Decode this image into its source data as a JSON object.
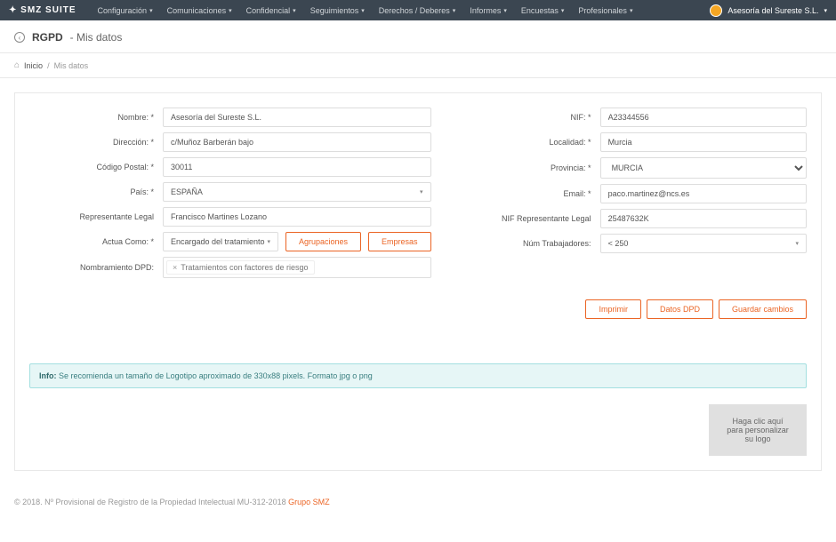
{
  "brand": "SMZ SUITE",
  "nav": [
    "Configuración",
    "Comunicaciones",
    "Confidencial",
    "Seguimientos",
    "Derechos / Deberes",
    "Informes",
    "Encuestas",
    "Profesionales"
  ],
  "user_name": "Asesoría del Sureste S.L.",
  "page": {
    "title_main": "RGPD",
    "title_sub": "- Mis datos"
  },
  "breadcrumb": {
    "home": "Inicio",
    "sep": "/",
    "current": "Mis datos"
  },
  "labels": {
    "nombre": "Nombre: *",
    "nif": "NIF: *",
    "direccion": "Dirección: *",
    "localidad": "Localidad: *",
    "cpostal": "Código Postal: *",
    "provincia": "Provincia: *",
    "pais": "País: *",
    "email": "Email: *",
    "replegal": "Representante Legal",
    "nifrep": "NIF Representante Legal",
    "actua": "Actua Como: *",
    "ntrab": "Núm Trabajadores:",
    "dpd": "Nombramiento DPD:"
  },
  "values": {
    "nombre": "Asesoría del Sureste S.L.",
    "nif": "A23344556",
    "direccion": "c/Muñoz Barberán bajo",
    "localidad": "Murcia",
    "cpostal": "30011",
    "provincia": "MURCIA",
    "pais": "ESPAÑA",
    "email": "paco.martinez@ncs.es",
    "replegal": "Francisco Martines Lozano",
    "nifrep": "25487632K",
    "actua": "Encargado del tratamiento",
    "ntrab": "< 250",
    "dpd_tag": "Tratamientos con factores de riesgo"
  },
  "buttons": {
    "agrupaciones": "Agrupaciones",
    "empresas": "Empresas",
    "imprimir": "Imprimir",
    "datosdpd": "Datos DPD",
    "guardar": "Guardar cambios"
  },
  "info": {
    "label": "Info:",
    "text": " Se recomienda un tamaño de Logotipo aproximado de 330x88 pixels. Formato jpg o png"
  },
  "logo_drop": "Haga clic aquí para personalizar su logo",
  "footer": {
    "text": "© 2018. Nº Provisional de Registro de la Propiedad Intelectual MU-312-2018 ",
    "link": "Grupo SMZ"
  }
}
